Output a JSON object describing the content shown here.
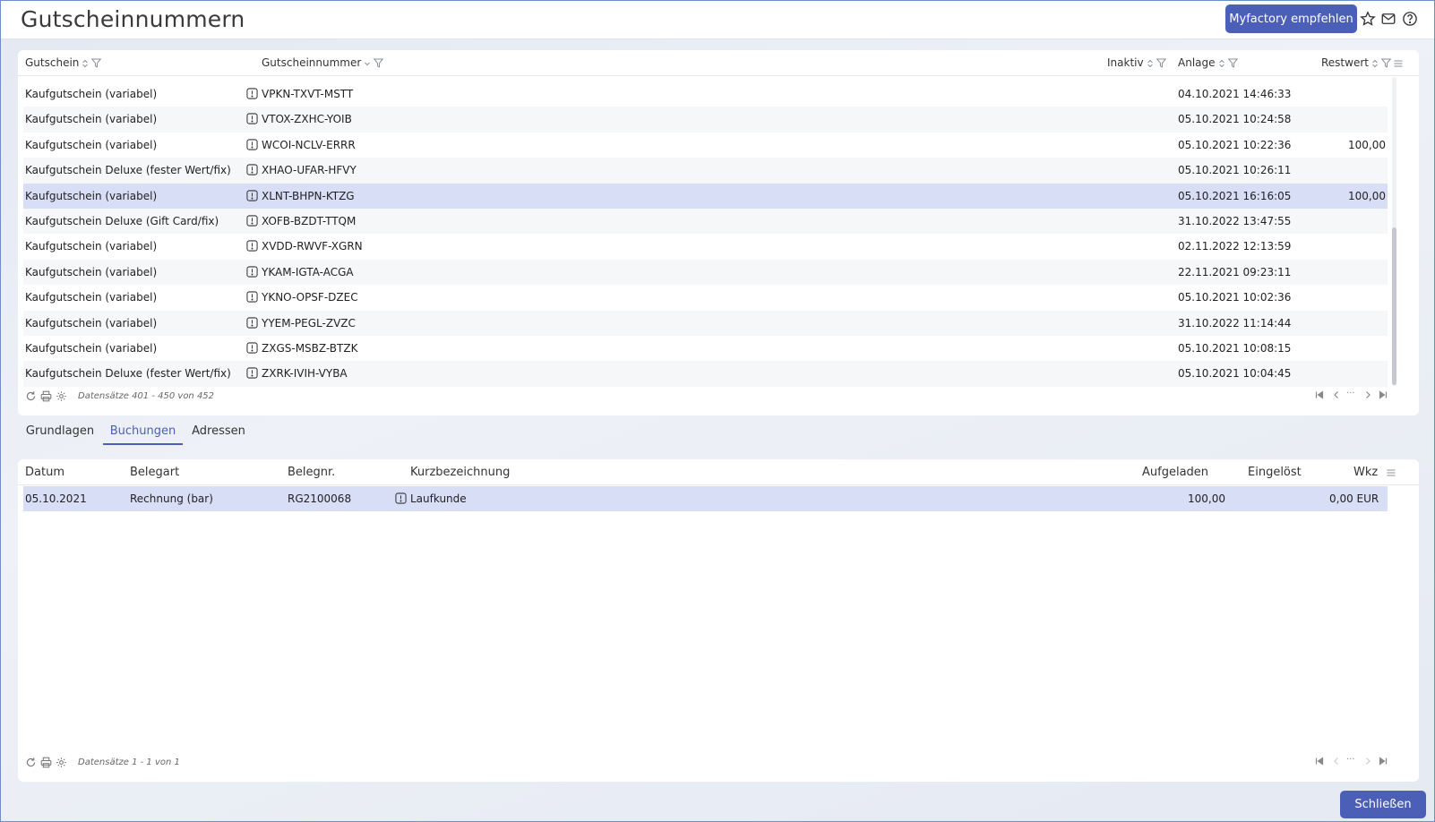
{
  "header": {
    "title": "Gutscheinnummern",
    "recommend_label": "Myfactory empfehlen",
    "icons": [
      "star-icon",
      "mail-icon",
      "help-icon"
    ]
  },
  "voucher_grid": {
    "columns": {
      "gutschein": "Gutschein",
      "nummer": "Gutscheinnummer",
      "inaktiv": "Inaktiv",
      "anlage": "Anlage",
      "restwert": "Restwert"
    },
    "rows": [
      {
        "name": "Kaufgutschein (variabel)",
        "code": "VPKN-TXVT-MSTT",
        "anlage": "04.10.2021 14:46:33",
        "restwert": ""
      },
      {
        "name": "Kaufgutschein (variabel)",
        "code": "VTOX-ZXHC-YOIB",
        "anlage": "05.10.2021 10:24:58",
        "restwert": ""
      },
      {
        "name": "Kaufgutschein (variabel)",
        "code": "WCOI-NCLV-ERRR",
        "anlage": "05.10.2021 10:22:36",
        "restwert": "100,00"
      },
      {
        "name": "Kaufgutschein Deluxe (fester Wert/fix)",
        "code": "XHAO-UFAR-HFVY",
        "anlage": "05.10.2021 10:26:11",
        "restwert": ""
      },
      {
        "name": "Kaufgutschein (variabel)",
        "code": "XLNT-BHPN-KTZG",
        "anlage": "05.10.2021 16:16:05",
        "restwert": "100,00",
        "selected": true
      },
      {
        "name": "Kaufgutschein Deluxe (Gift Card/fix)",
        "code": "XOFB-BZDT-TTQM",
        "anlage": "31.10.2022 13:47:55",
        "restwert": ""
      },
      {
        "name": "Kaufgutschein (variabel)",
        "code": "XVDD-RWVF-XGRN",
        "anlage": "02.11.2022 12:13:59",
        "restwert": ""
      },
      {
        "name": "Kaufgutschein (variabel)",
        "code": "YKAM-IGTA-ACGA",
        "anlage": "22.11.2021 09:23:11",
        "restwert": ""
      },
      {
        "name": "Kaufgutschein (variabel)",
        "code": "YKNO-OPSF-DZEC",
        "anlage": "05.10.2021 10:02:36",
        "restwert": ""
      },
      {
        "name": "Kaufgutschein (variabel)",
        "code": "YYEM-PEGL-ZVZC",
        "anlage": "31.10.2022 11:14:44",
        "restwert": ""
      },
      {
        "name": "Kaufgutschein (variabel)",
        "code": "ZXGS-MSBZ-BTZK",
        "anlage": "05.10.2021 10:08:15",
        "restwert": ""
      },
      {
        "name": "Kaufgutschein Deluxe (fester Wert/fix)",
        "code": "ZXRK-IVIH-VYBA",
        "anlage": "05.10.2021 10:04:45",
        "restwert": ""
      }
    ],
    "footer_text": "Datensätze 401 - 450 von 452",
    "pager_dots": "···"
  },
  "tabs": [
    "Grundlagen",
    "Buchungen",
    "Adressen"
  ],
  "active_tab": "Buchungen",
  "booking_grid": {
    "columns": {
      "datum": "Datum",
      "belegart": "Belegart",
      "belegnr": "Belegnr.",
      "kurz": "Kurzbezeichnung",
      "aufgeladen": "Aufgeladen",
      "eingeloest": "Eingelöst",
      "wkz": "Wkz"
    },
    "rows": [
      {
        "datum": "05.10.2021",
        "belegart": "Rechnung (bar)",
        "belegnr": "RG2100068",
        "kurz": "Laufkunde",
        "aufgeladen": "100,00",
        "eingeloest_wkz": "0,00 EUR"
      }
    ],
    "footer_text": "Datensätze 1 - 1 von 1",
    "pager_dots": "···"
  },
  "close_label": "Schließen",
  "colors": {
    "accent": "#4a5fb5",
    "selected_row": "#d7def6"
  }
}
